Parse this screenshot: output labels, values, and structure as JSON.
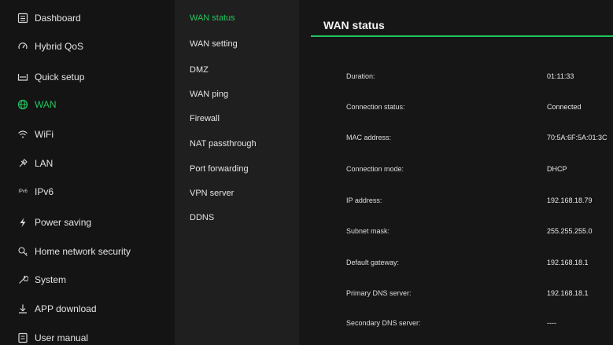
{
  "sidebar": {
    "items": [
      {
        "label": "Dashboard",
        "icon": "dashboard-icon"
      },
      {
        "label": "Hybrid QoS",
        "icon": "qos-icon"
      },
      {
        "label": "Quick setup",
        "icon": "quick-setup-icon"
      },
      {
        "label": "WAN",
        "icon": "globe-icon",
        "active": true
      },
      {
        "label": "WiFi",
        "icon": "wifi-icon"
      },
      {
        "label": "LAN",
        "icon": "lan-icon"
      },
      {
        "label": "IPv6",
        "icon": "ipv6-icon",
        "icon_text": "IPv6"
      },
      {
        "label": "Power saving",
        "icon": "lightning-icon"
      },
      {
        "label": "Home network security",
        "icon": "security-icon"
      },
      {
        "label": "System",
        "icon": "system-icon"
      },
      {
        "label": "APP download",
        "icon": "download-icon"
      },
      {
        "label": "User manual",
        "icon": "manual-icon"
      }
    ]
  },
  "submenu": {
    "items": [
      {
        "label": "WAN status",
        "active": true
      },
      {
        "label": "WAN setting"
      },
      {
        "label": "DMZ"
      },
      {
        "label": "WAN ping"
      },
      {
        "label": "Firewall"
      },
      {
        "label": "NAT passthrough"
      },
      {
        "label": "Port forwarding"
      },
      {
        "label": "VPN server"
      },
      {
        "label": "DDNS"
      }
    ]
  },
  "main": {
    "title": "WAN status",
    "rows": [
      {
        "label": "Duration:",
        "value": "01:11:33"
      },
      {
        "label": "Connection status:",
        "value": "Connected"
      },
      {
        "label": "MAC address:",
        "value": "70:5A:6F:5A:01:3C"
      },
      {
        "label": "Connection mode:",
        "value": "DHCP"
      },
      {
        "label": "IP address:",
        "value": "192.168.18.79"
      },
      {
        "label": "Subnet mask:",
        "value": "255.255.255.0"
      },
      {
        "label": "Default gateway:",
        "value": "192.168.18.1"
      },
      {
        "label": "Primary DNS server:",
        "value": "192.168.18.1"
      },
      {
        "label": "Secondary DNS server:",
        "value": "----"
      }
    ]
  },
  "colors": {
    "accent": "#23c45e",
    "sidebar_bg": "#141414",
    "submenu_bg": "#1f1f1f",
    "main_bg": "#161616"
  }
}
